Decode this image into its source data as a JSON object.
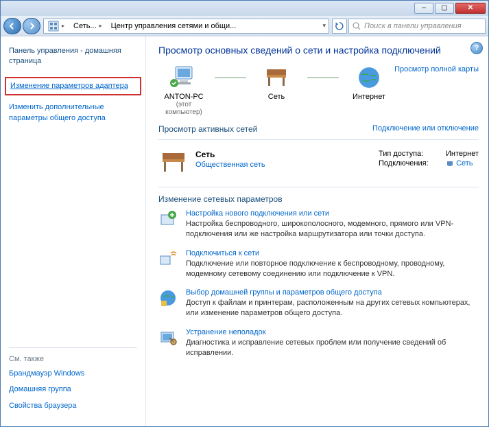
{
  "titlebar": {
    "min": "–",
    "max": "▢",
    "close": "✕"
  },
  "nav": {
    "addr_icon": "control-panel",
    "path1": "Сеть...",
    "path2": "Центр управления сетями и общи...",
    "chev": "▸",
    "dropdown": "▾",
    "search_placeholder": "Поиск в панели управления"
  },
  "sidebar": {
    "home": "Панель управления - домашняя страница",
    "link_adapter": "Изменение параметров адаптера",
    "link_advanced": "Изменить дополнительные параметры общего доступа",
    "seealso_title": "См. также",
    "seealso": [
      "Брандмауэр Windows",
      "Домашняя группа",
      "Свойства браузера"
    ]
  },
  "main": {
    "title": "Просмотр основных сведений о сети и настройка подключений",
    "fullmap": "Просмотр полной карты",
    "nodes": {
      "pc": "ANTON-PC",
      "pc_sub": "(этот компьютер)",
      "net": "Сеть",
      "inet": "Интернет"
    },
    "active_title": "Просмотр активных сетей",
    "active_link": "Подключение или отключение",
    "active": {
      "name": "Сеть",
      "type": "Общественная сеть",
      "access_lbl": "Тип доступа:",
      "access_val": "Интернет",
      "conn_lbl": "Подключения:",
      "conn_val": "Сеть"
    },
    "settings_title": "Изменение сетевых параметров",
    "items": [
      {
        "link": "Настройка нового подключения или сети",
        "desc": "Настройка беспроводного, широкополосного, модемного, прямого или VPN-подключения или же настройка маршрутизатора или точки доступа."
      },
      {
        "link": "Подключиться к сети",
        "desc": "Подключение или повторное подключение к беспроводному, проводному, модемному сетевому соединению или подключение к VPN."
      },
      {
        "link": "Выбор домашней группы и параметров общего доступа",
        "desc": "Доступ к файлам и принтерам, расположенным на других сетевых компьютерах, или изменение параметров общего доступа."
      },
      {
        "link": "Устранение неполадок",
        "desc": "Диагностика и исправление сетевых проблем или получение сведений об исправлении."
      }
    ]
  }
}
